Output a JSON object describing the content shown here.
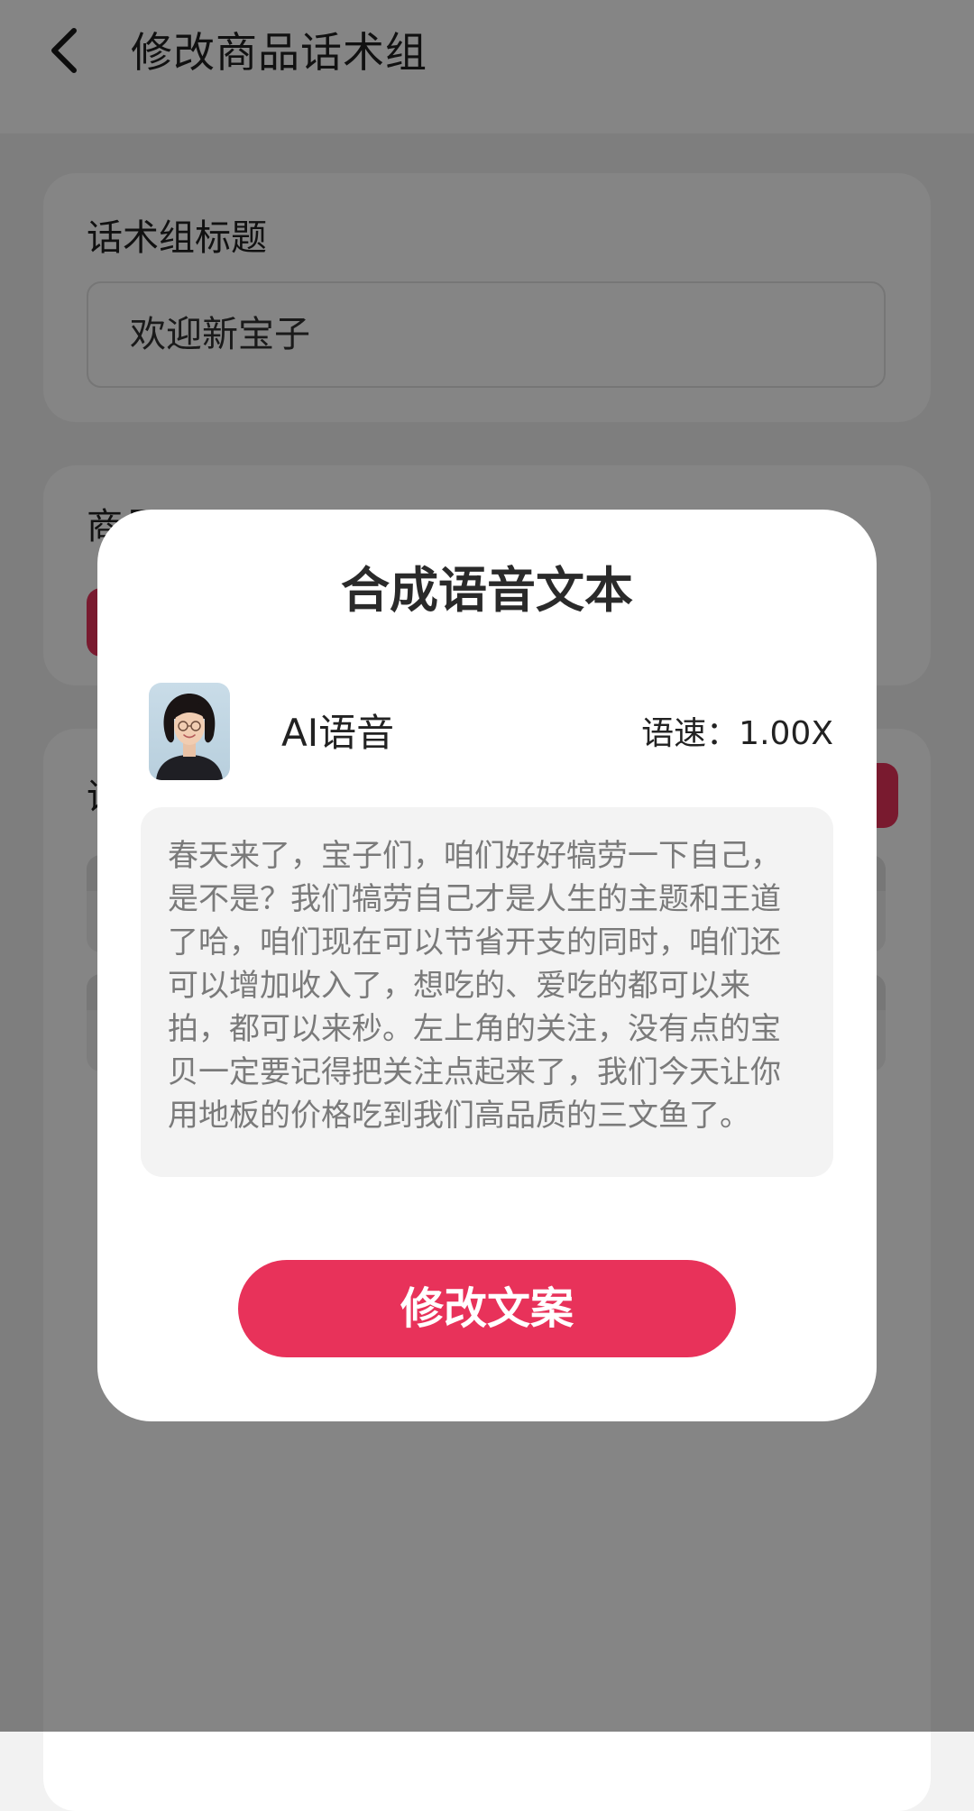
{
  "header": {
    "title": "修改商品话术组",
    "back_icon": "chevron-left-icon"
  },
  "title_section": {
    "label": "话术组标题",
    "input_value": "欢迎新宝子"
  },
  "product_section": {
    "label_partial": "商品"
  },
  "script_section": {
    "label_partial": "话"
  },
  "modal": {
    "title": "合成语音文本",
    "voice_name": "AI语音",
    "speed_label": "语速：",
    "speed_value": "1.00X",
    "text": "春天来了，宝子们，咱们好好犒劳一下自己，是不是？我们犒劳自己才是人生的主题和王道了哈，咱们现在可以节省开支的同时，咱们还可以增加收入了，想吃的、爱吃的都可以来拍，都可以来秒。左上角的关注，没有点的宝贝一定要记得把关注点起来了，我们今天让你用地板的价格吃到我们高品质的三文鱼了。",
    "button_label": "修改文案"
  },
  "colors": {
    "accent": "#e8325a",
    "scrim": "rgba(0,0,0,0.48)",
    "text_box_bg": "#f3f3f3"
  }
}
